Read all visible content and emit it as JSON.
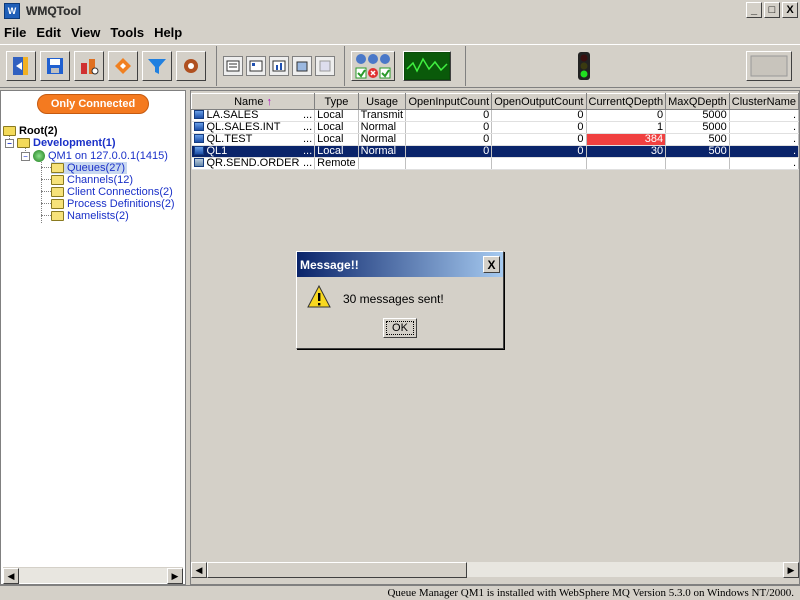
{
  "window": {
    "title": "WMQTool",
    "icon_label": "W",
    "min_label": "_",
    "restore_label": "□",
    "close_label": "X"
  },
  "menu": [
    "File",
    "Edit",
    "View",
    "Tools",
    "Help"
  ],
  "toolbar": {
    "icons": [
      "exit-icon",
      "save-icon",
      "connect-icon",
      "refresh-icon",
      "filter-icon",
      "settings-icon",
      "view-list-icon",
      "view-detail-icon",
      "view-chart-icon",
      "view-cube-icon",
      "blank-icon",
      "status-icons",
      "monitor-icon",
      "traffic-light-icon",
      "placeholder-icon"
    ]
  },
  "left": {
    "only_connected": "Only Connected",
    "tree": {
      "root": "Root(2)",
      "development": "Development(1)",
      "qm": "QM1  on 127.0.0.1(1415)",
      "queues": "Queues(27)",
      "channels": "Channels(12)",
      "client_connections": "Client Connections(2)",
      "process_definitions": "Process Definitions(2)",
      "namelists": "Namelists(2)"
    }
  },
  "table": {
    "headers": [
      "Name",
      "Type",
      "Usage",
      "OpenInputCount",
      "OpenOutputCount",
      "CurrentQDepth",
      "MaxQDepth",
      "ClusterName"
    ],
    "sort_arrow": "↑",
    "rows": [
      {
        "name": "LA.SALES",
        "ellipsis": "...",
        "type": "Local",
        "usage": "Transmit",
        "in": "0",
        "out": "0",
        "cur": "0",
        "max": "5000",
        "cluster": "."
      },
      {
        "name": "QL.SALES.INT",
        "ellipsis": "...",
        "type": "Local",
        "usage": "Normal",
        "in": "0",
        "out": "0",
        "cur": "1",
        "max": "5000",
        "cluster": "."
      },
      {
        "name": "QL.TEST",
        "ellipsis": "...",
        "type": "Local",
        "usage": "Normal",
        "in": "0",
        "out": "0",
        "cur": "384",
        "max": "500",
        "cluster": "."
      },
      {
        "name": "QL1",
        "ellipsis": "...",
        "type": "Local",
        "usage": "Normal",
        "in": "0",
        "out": "0",
        "cur": "30",
        "max": "500",
        "cluster": "."
      },
      {
        "name": "QR.SEND.ORDER",
        "ellipsis": "...",
        "type": "Remote",
        "usage": "",
        "in": "",
        "out": "",
        "cur": "",
        "max": "",
        "cluster": "."
      }
    ]
  },
  "dialog": {
    "title": "Message!!",
    "message": "30 messages sent!",
    "ok": "OK",
    "close": "X"
  },
  "status": {
    "text": "Queue Manager QM1  is installed with WebSphere MQ Version 5.3.0 on Windows NT/2000."
  },
  "colors": {
    "selection": "#0a246a",
    "alert": "#f04040",
    "only_connected": "#f47a20"
  }
}
